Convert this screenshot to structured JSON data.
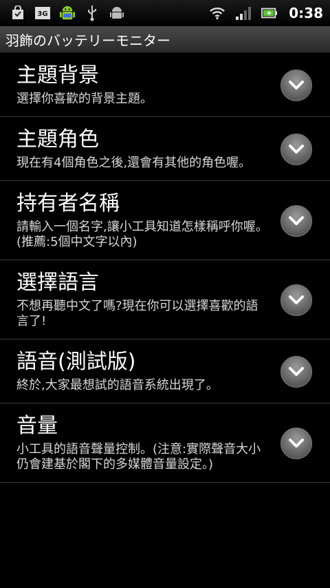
{
  "statusbar": {
    "time": "0:38",
    "left_icons": [
      "shopping-bag-icon",
      "3g-icon",
      "android-icon",
      "usb-icon",
      "android-debug-icon"
    ],
    "right_icons": [
      "wifi-icon",
      "signal-icon",
      "battery-icon"
    ]
  },
  "app": {
    "title": "羽飾のバッテリーモニター"
  },
  "settings": [
    {
      "title": "主題背景",
      "summary": "選擇你喜歡的背景主題。"
    },
    {
      "title": "主題角色",
      "summary": "現在有4個角色之後,還會有其他的角色喔。"
    },
    {
      "title": "持有者名稱",
      "summary": "請輸入一個名字,讓小工具知道怎樣稱呼你喔。(推薦:5個中文字以內)"
    },
    {
      "title": "選擇語言",
      "summary": "不想再聽中文了嗎?現在你可以選擇喜歡的語言了!"
    },
    {
      "title": "語音(測試版)",
      "summary": "終於,大家最想試的語音系統出現了。"
    },
    {
      "title": "音量",
      "summary": "小工具的語音聲量控制。(注意:實際聲音大小仍會建基於閣下的多媒體音量設定。)"
    }
  ],
  "colors": {
    "background": "#000000",
    "divider": "#3a3a3a",
    "battery_accent": "#5ec23a"
  }
}
